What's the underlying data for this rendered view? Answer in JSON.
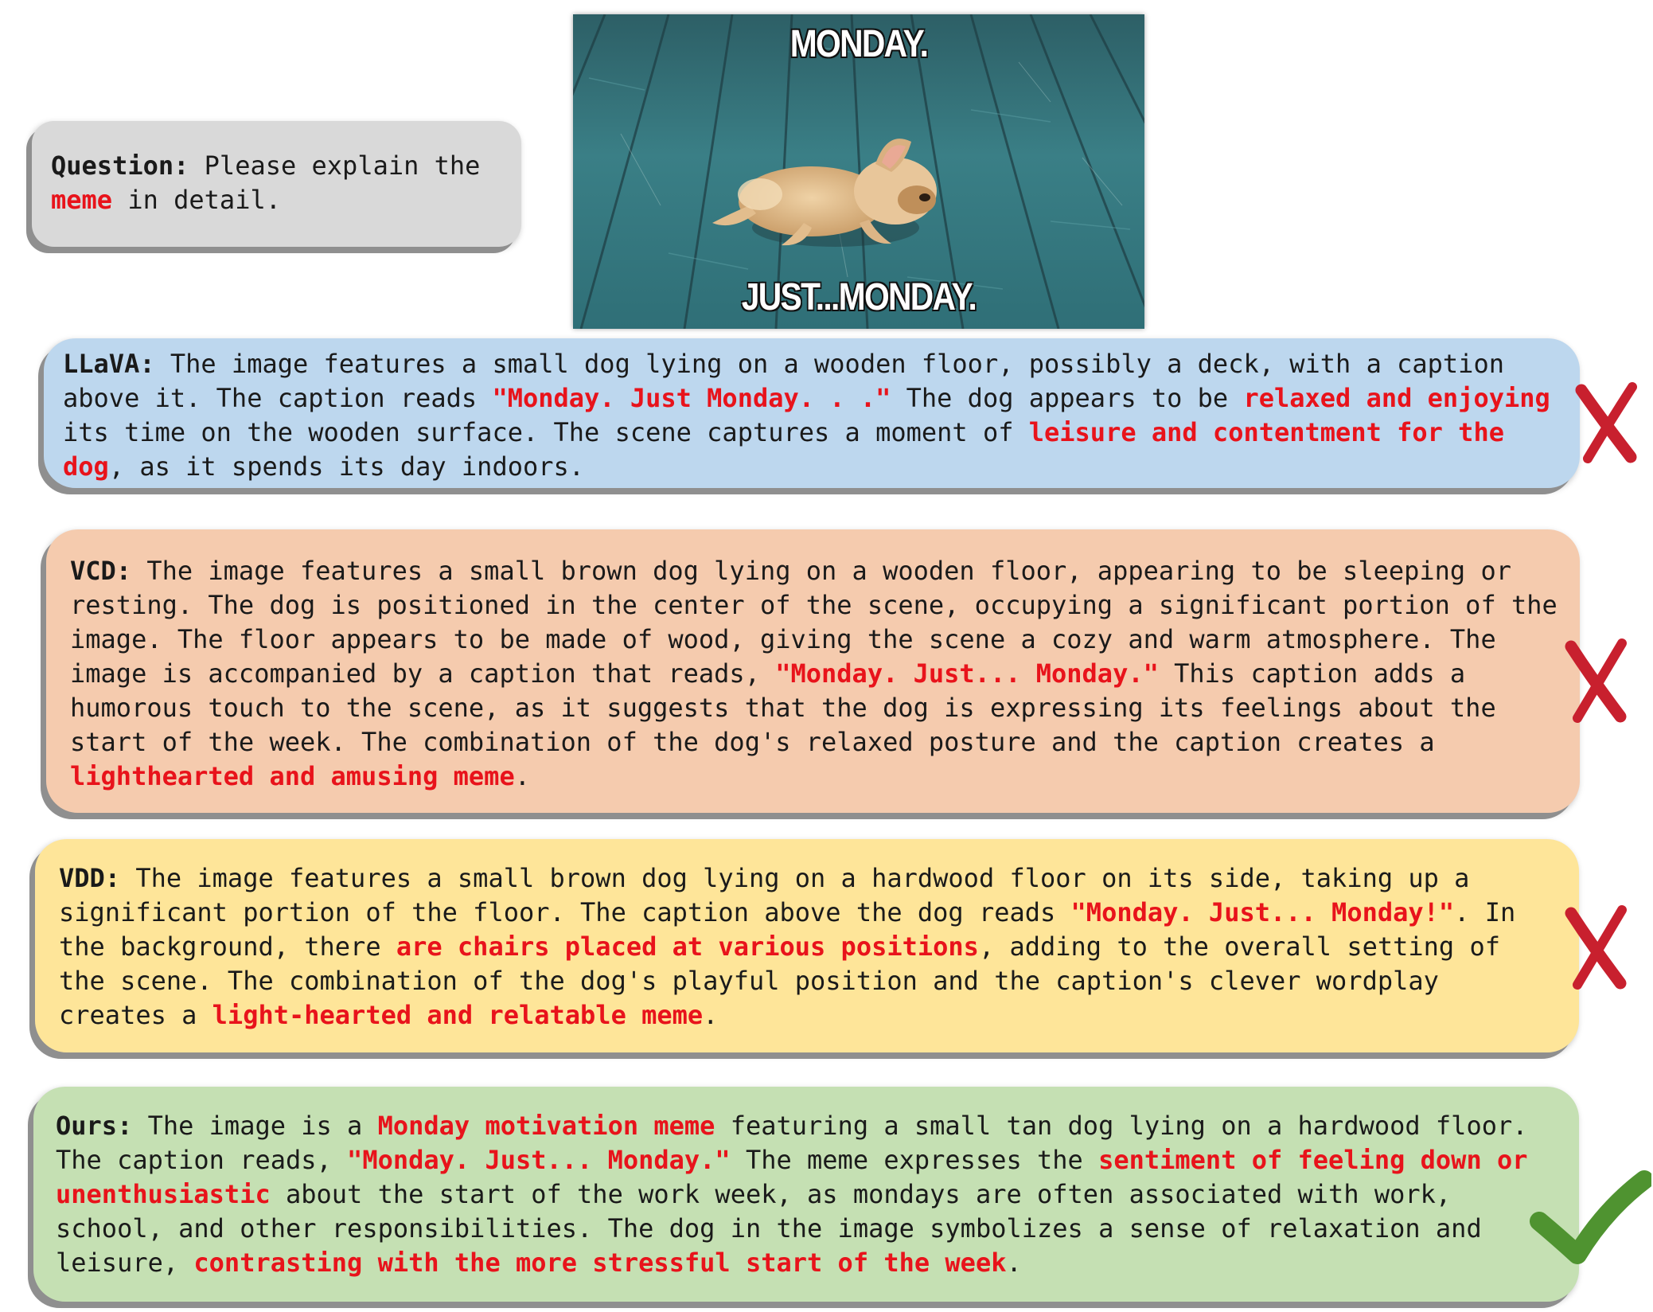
{
  "question": {
    "label": "Question:",
    "parts": [
      {
        "text": " Please explain the ",
        "hl": false
      },
      {
        "text": "meme",
        "hl": true
      },
      {
        "text": " in detail.",
        "hl": false
      }
    ]
  },
  "meme": {
    "top_caption": "MONDAY.",
    "bottom_caption": "JUST...MONDAY."
  },
  "answers": {
    "llava": {
      "label": "LLaVA:",
      "verdict": "cross",
      "parts": [
        {
          "text": " The image features a small dog lying on a wooden floor, possibly a deck, with a caption above it. The caption reads ",
          "hl": false
        },
        {
          "text": "\"Monday. Just Monday. . .\"",
          "hl": true
        },
        {
          "text": " The dog appears to be ",
          "hl": false
        },
        {
          "text": "relaxed and enjoying",
          "hl": true
        },
        {
          "text": " its time on the wooden surface. The scene captures a moment of ",
          "hl": false
        },
        {
          "text": "leisure and contentment for the dog",
          "hl": true
        },
        {
          "text": ", as it spends its day indoors.",
          "hl": false
        }
      ]
    },
    "vcd": {
      "label": "VCD:",
      "verdict": "cross",
      "parts": [
        {
          "text": " The image features a small brown dog lying on a wooden floor, appearing to be sleeping or resting. The dog is positioned in the center of the scene, occupying a significant portion of the image. The floor appears to be made of wood, giving the scene a cozy and warm atmosphere. The image is accompanied by a caption that reads, ",
          "hl": false
        },
        {
          "text": "\"Monday. Just... Monday.\"",
          "hl": true
        },
        {
          "text": " This caption adds a humorous touch to the scene, as it suggests that the dog is expressing its feelings about the start of the week. The combination of the dog's relaxed posture and the caption creates a ",
          "hl": false
        },
        {
          "text": "lighthearted and amusing meme",
          "hl": true
        },
        {
          "text": ".",
          "hl": false
        }
      ]
    },
    "vdd": {
      "label": "VDD:",
      "verdict": "cross",
      "parts": [
        {
          "text": " The image features a small brown dog lying on a hardwood floor on its side, taking up a significant portion of the floor. The caption above the dog reads ",
          "hl": false
        },
        {
          "text": "\"Monday. Just... Monday!\"",
          "hl": true
        },
        {
          "text": ". In the background, there ",
          "hl": false
        },
        {
          "text": "are chairs placed at various positions",
          "hl": true
        },
        {
          "text": ", adding to the overall setting of the scene. The combination of the dog's playful position and the caption's clever wordplay creates a ",
          "hl": false
        },
        {
          "text": "light-hearted and relatable meme",
          "hl": true
        },
        {
          "text": ".",
          "hl": false
        }
      ]
    },
    "ours": {
      "label": "Ours:",
      "verdict": "check",
      "parts": [
        {
          "text": " The image is a ",
          "hl": false
        },
        {
          "text": "Monday motivation meme",
          "hl": true
        },
        {
          "text": " featuring a small tan dog lying on a hardwood floor. The caption reads, ",
          "hl": false
        },
        {
          "text": "\"Monday. Just... Monday.\"",
          "hl": true
        },
        {
          "text": " The meme expresses the ",
          "hl": false
        },
        {
          "text": "sentiment of feeling down or unenthusiastic",
          "hl": true
        },
        {
          "text": " about the start of the work week, as mondays are often associated with work, school, and other responsibilities. The dog in the image symbolizes a sense of relaxation and leisure, ",
          "hl": false
        },
        {
          "text": "contrasting with the more stressful start of the week",
          "hl": true
        },
        {
          "text": ".",
          "hl": false
        }
      ]
    }
  },
  "colors": {
    "highlight": "#e8131b",
    "cross": "#c8202e",
    "check": "#4f9330",
    "question_bg": "#d9d9d9",
    "llava_bg": "#bdd7ee",
    "vcd_bg": "#f5cbae",
    "vdd_bg": "#fee599",
    "ours_bg": "#c5e0b3"
  }
}
